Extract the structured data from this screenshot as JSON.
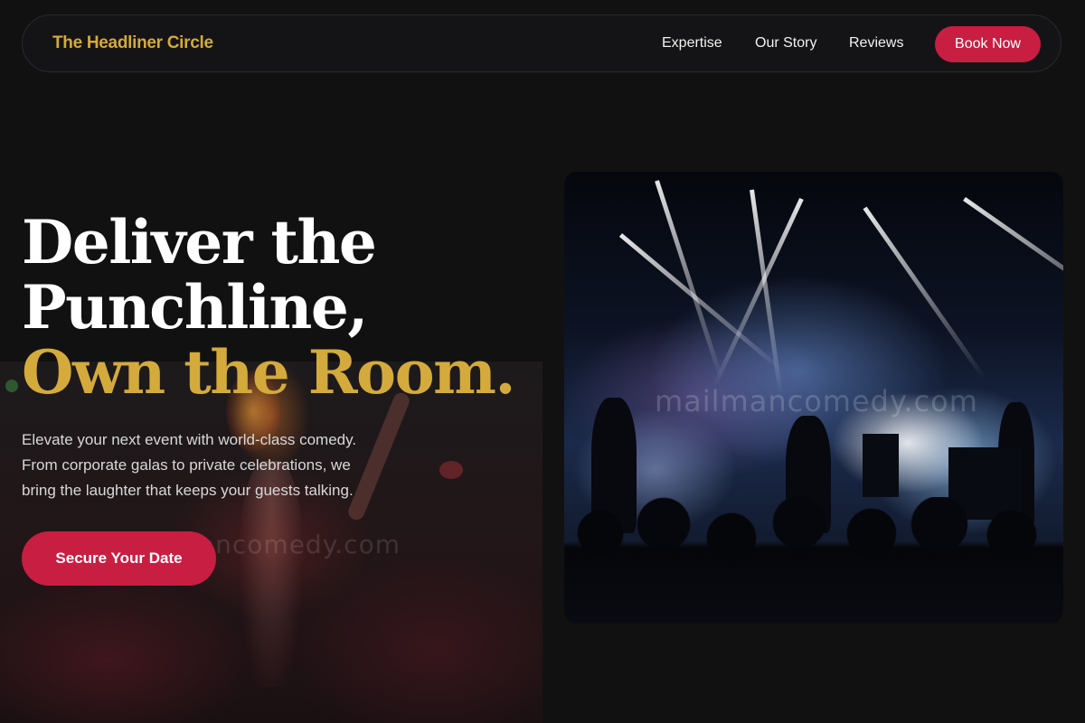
{
  "brand": {
    "name": "The Headliner Circle"
  },
  "nav": {
    "links": [
      "Expertise",
      "Our Story",
      "Reviews"
    ],
    "book_label": "Book Now"
  },
  "hero": {
    "headline": [
      "Deliver the",
      "Punchline,",
      "Own the Room."
    ],
    "subtext": [
      "Elevate your next event with world-class comedy.",
      "From corporate galas to private celebrations, we",
      "bring the laughter that keeps your guests talking."
    ],
    "cta_label": "Secure Your Date"
  },
  "watermark": {
    "text": "mailmancomedy.com",
    "partial_text": "ancomedy.com"
  },
  "colors": {
    "background": "#111112",
    "accent_gold": "#d4aa3c",
    "accent_red": "#c81e42"
  }
}
